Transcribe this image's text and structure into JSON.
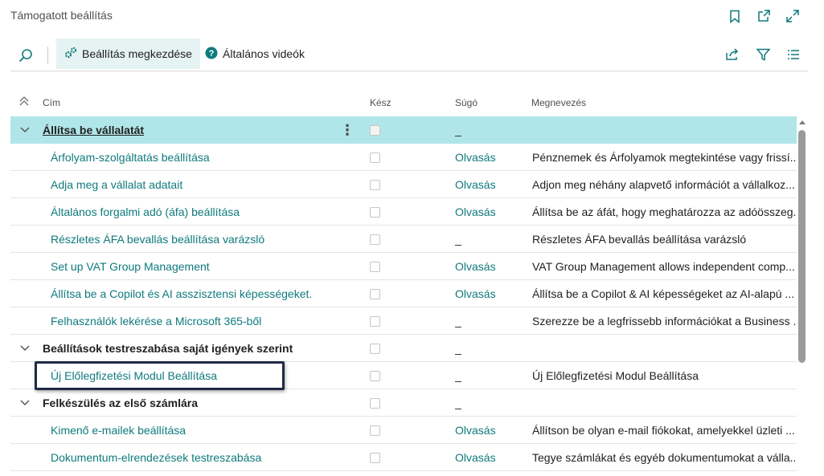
{
  "window": {
    "title": "Támogatott beállítás",
    "icons": [
      "bookmark-icon",
      "open-new-window-icon",
      "expand-icon"
    ]
  },
  "actions": {
    "search_icon": "search-icon",
    "start_setup": "Beállítás megkezdése",
    "general_videos": "Általános videók",
    "right_icons": [
      "share-icon",
      "filter-icon",
      "list-view-icon"
    ]
  },
  "columns": {
    "title": "Cím",
    "done": "Kész",
    "help": "Súgó",
    "description": "Megnevezés"
  },
  "rows": [
    {
      "kind": "group",
      "title": "Állítsa be vállalatát",
      "help": "_",
      "description": "",
      "selected": true
    },
    {
      "kind": "item",
      "title": "Árfolyam-szolgáltatás beállítása",
      "help": "Olvasás",
      "description": "Pénznemek és Árfolyamok megtekintése vagy frissí..."
    },
    {
      "kind": "item",
      "title": "Adja meg a vállalat adatait",
      "help": "Olvasás",
      "description": "Adjon meg néhány alapvető információt a vállalkoz..."
    },
    {
      "kind": "item",
      "title": "Általános forgalmi adó (áfa) beállítása",
      "help": "Olvasás",
      "description": "Állítsa be az áfát, hogy meghatározza az adóösszeg..."
    },
    {
      "kind": "item",
      "title": "Részletes ÁFA bevallás beállítása varázsló",
      "help": "_",
      "description": "Részletes ÁFA bevallás beállítása varázsló"
    },
    {
      "kind": "item",
      "title": "Set up VAT Group Management",
      "help": "Olvasás",
      "description": "VAT Group Management allows independent comp..."
    },
    {
      "kind": "item",
      "title": "Állítsa be a Copilot és AI asszisztensi képességeket.",
      "help": "Olvasás",
      "description": "Állítsa be a Copilot & AI képességeket az AI-alapú ..."
    },
    {
      "kind": "item",
      "title": "Felhasználók lekérése a Microsoft 365-ből",
      "help": "_",
      "description": "Szerezze be a legfrissebb információkat a Business ..."
    },
    {
      "kind": "group",
      "title": "Beállítások testreszabása saját igények szerint",
      "help": "_",
      "description": ""
    },
    {
      "kind": "item",
      "title": "Új Előlegfizetési Modul Beállítása",
      "help": "_",
      "description": "Új Előlegfizetési Modul Beállítása"
    },
    {
      "kind": "group",
      "title": "Felkészülés az első számlára",
      "help": "_",
      "description": ""
    },
    {
      "kind": "item",
      "title": "Kimenő e-mailek beállítása",
      "help": "Olvasás",
      "description": "Állítson be olyan e-mail fiókokat, amelyekkel üzleti ..."
    },
    {
      "kind": "item",
      "title": "Dokumentum-elrendezések testreszabása",
      "help": "Olvasás",
      "description": "Tegye számlákat és egyéb dokumentumokat a válla..."
    }
  ]
}
